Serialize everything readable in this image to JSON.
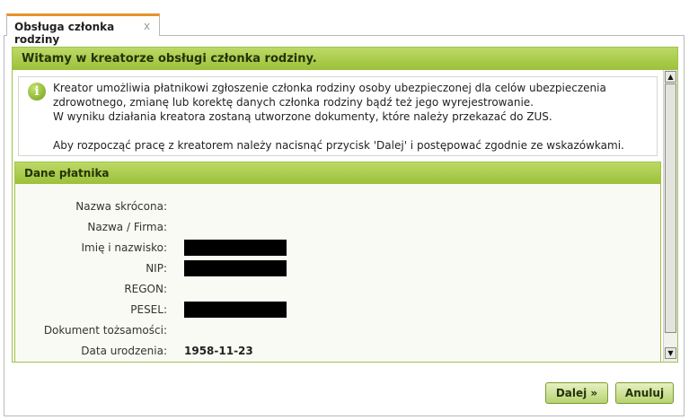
{
  "tab": {
    "label": "Obsługa członka rodziny",
    "close_glyph": "x"
  },
  "wizard": {
    "title": "Witamy w kreatorze obsługi członka rodziny.",
    "info": {
      "icon": "info-icon",
      "icon_glyph": "i",
      "line1": "Kreator umożliwia płatnikowi zgłoszenie członka rodziny osoby ubezpieczonej dla celów ubezpieczenia",
      "line2": "zdrowotnego, zmianę lub korektę danych członka rodziny bądź też jego wyrejestrowanie.",
      "line3": "W wyniku działania kreatora zostaną utworzone dokumenty, które należy przekazać do ZUS.",
      "line4": "Aby rozpocząć pracę z kreatorem należy nacisnąć przycisk 'Dalej' i postępować zgodnie ze wskazówkami."
    },
    "panel": {
      "title": "Dane płatnika",
      "fields": [
        {
          "label": "Nazwa skrócona:",
          "value": "",
          "redacted": false
        },
        {
          "label": "Nazwa / Firma:",
          "value": "",
          "redacted": false
        },
        {
          "label": "Imię i nazwisko:",
          "value": "",
          "redacted": true
        },
        {
          "label": "NIP:",
          "value": "",
          "redacted": true
        },
        {
          "label": "REGON:",
          "value": "",
          "redacted": false
        },
        {
          "label": "PESEL:",
          "value": "",
          "redacted": true
        },
        {
          "label": "Dokument tożsamości:",
          "value": "",
          "redacted": false
        },
        {
          "label": "Data urodzenia:",
          "value": "1958-11-23",
          "redacted": false
        }
      ]
    },
    "scrollbar": {
      "up_glyph": "▲",
      "down_glyph": "▼"
    }
  },
  "buttons": {
    "next_label": "Dalej »",
    "cancel_label": "Anuluj"
  },
  "colors": {
    "accent_green": "#9cc13a",
    "tab_accent": "#e8932a",
    "redaction": "#000000"
  }
}
